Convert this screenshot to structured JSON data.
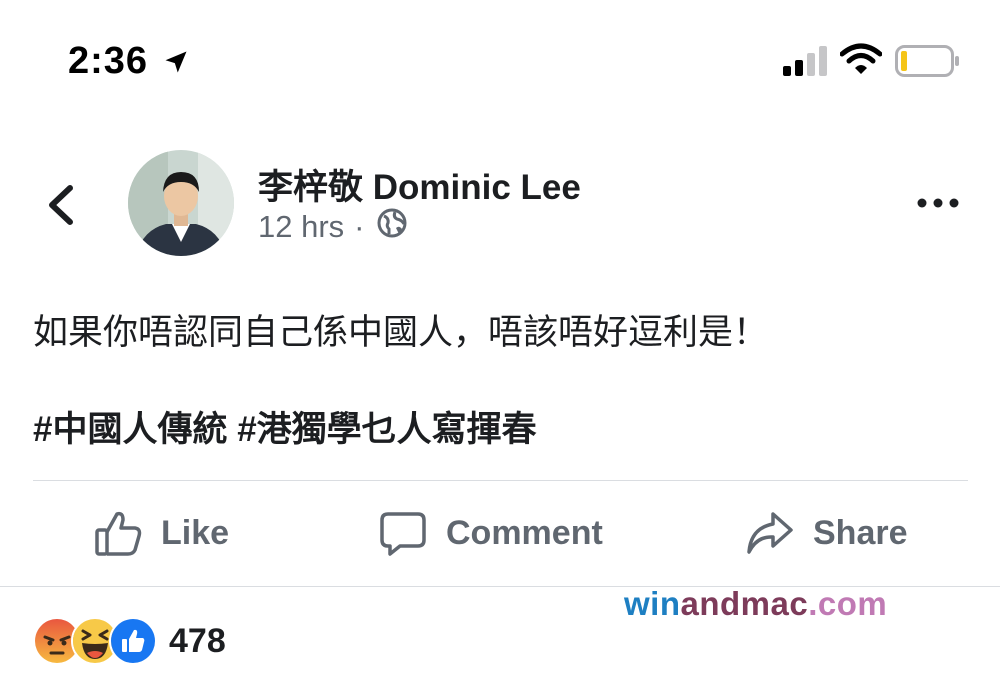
{
  "status_bar": {
    "time": "2:36",
    "icons": [
      "location-arrow-icon",
      "cellular-signal-icon",
      "wifi-icon",
      "battery-low-icon"
    ],
    "battery_color": "#f5c518"
  },
  "post": {
    "back_icon": "chevron-left-icon",
    "author": "李梓敬 Dominic Lee",
    "time": "12 hrs",
    "separator": "·",
    "privacy_icon": "globe-icon",
    "more_icon": "more-horizontal-icon",
    "text": "如果你唔認同自己係中國人，唔該唔好逗利是！",
    "hashtags": "#中國人傳統 #港獨學乜人寫揮春"
  },
  "actions": {
    "like": "Like",
    "comment": "Comment",
    "share": "Share"
  },
  "watermark": {
    "part1": "win",
    "part2": "andmac",
    "part3": ".com"
  },
  "reactions": {
    "types": [
      "angry",
      "haha",
      "like"
    ],
    "count": "478"
  },
  "colors": {
    "text": "#1c1e21",
    "secondary": "#606770",
    "like_blue": "#1877f2",
    "angry_red": "#e9573f",
    "haha_yellow": "#f7c948"
  }
}
